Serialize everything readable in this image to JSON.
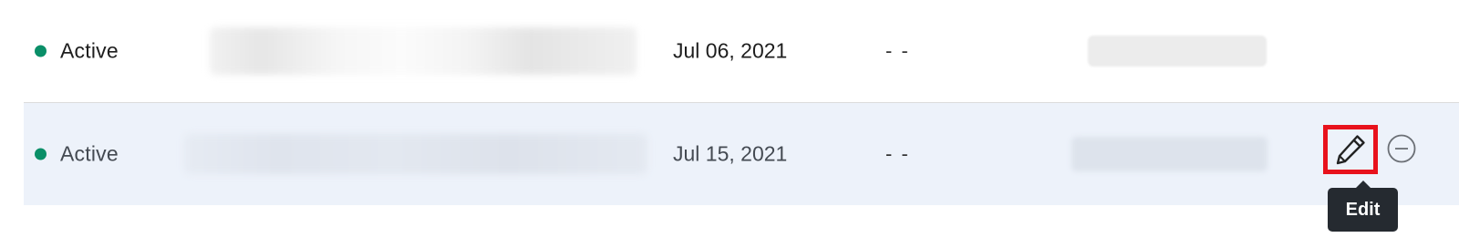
{
  "rows": [
    {
      "status": "Active",
      "date": "Jul 06, 2021",
      "value": "- -"
    },
    {
      "status": "Active",
      "date": "Jul 15, 2021",
      "value": "- -"
    }
  ],
  "actions": {
    "edit_icon": "pencil-icon",
    "remove_icon": "minus-circle-icon"
  },
  "tooltip": {
    "label": "Edit"
  },
  "colors": {
    "status_active": "#0a8f68",
    "highlight_border": "#e8121c",
    "selected_row_bg": "#edf2fa",
    "tooltip_bg": "#252a30"
  }
}
